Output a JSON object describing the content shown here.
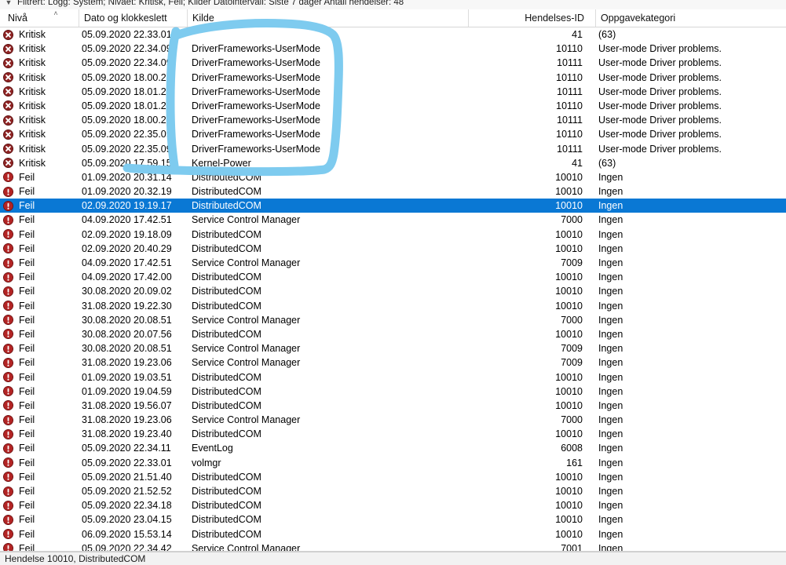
{
  "window": {
    "filter_bar_text": "Filtrert: Logg: System; Nivået: Kritisk, Feil; Kilder Datointervall: Siste 7 dager Antall hendelser: 48",
    "filter_bar_caret": "▼"
  },
  "columns": {
    "level": "Nivå",
    "datetime": "Dato og klokkeslett",
    "source": "Kilde",
    "event_id": "Hendelses-ID",
    "task_category": "Oppgavekategori",
    "sort_caret": "˄"
  },
  "icons": {
    "critical": "critical-error-icon",
    "error": "error-icon"
  },
  "colors": {
    "selection": "#0a78d4",
    "annotation_blue": "#7ecbef",
    "critical_icon": "#8e2323",
    "error_icon": "#b32424"
  },
  "statusbar": {
    "text": "Hendelse 10010, DistributedCOM"
  },
  "annotation": {
    "description": "hand-drawn blue rectangle around the DriverFrameworks-UserMode source entries"
  },
  "rows": [
    {
      "level": "Kritisk",
      "sev": "critical",
      "datetime": "05.09.2020 22.33.01",
      "source": "",
      "event_id": "41",
      "task_category": "(63)",
      "selected": false
    },
    {
      "level": "Kritisk",
      "sev": "critical",
      "datetime": "05.09.2020 22.34.09",
      "source": "DriverFrameworks-UserMode",
      "event_id": "10110",
      "task_category": "User-mode Driver problems.",
      "selected": false
    },
    {
      "level": "Kritisk",
      "sev": "critical",
      "datetime": "05.09.2020 22.34.09",
      "source": "DriverFrameworks-UserMode",
      "event_id": "10111",
      "task_category": "User-mode Driver problems.",
      "selected": false
    },
    {
      "level": "Kritisk",
      "sev": "critical",
      "datetime": "05.09.2020 18.00.24",
      "source": "DriverFrameworks-UserMode",
      "event_id": "10110",
      "task_category": "User-mode Driver problems.",
      "selected": false
    },
    {
      "level": "Kritisk",
      "sev": "critical",
      "datetime": "05.09.2020 18.01.24",
      "source": "DriverFrameworks-UserMode",
      "event_id": "10111",
      "task_category": "User-mode Driver problems.",
      "selected": false
    },
    {
      "level": "Kritisk",
      "sev": "critical",
      "datetime": "05.09.2020 18.01.24",
      "source": "DriverFrameworks-UserMode",
      "event_id": "10110",
      "task_category": "User-mode Driver problems.",
      "selected": false
    },
    {
      "level": "Kritisk",
      "sev": "critical",
      "datetime": "05.09.2020 18.00.24",
      "source": "DriverFrameworks-UserMode",
      "event_id": "10111",
      "task_category": "User-mode Driver problems.",
      "selected": false
    },
    {
      "level": "Kritisk",
      "sev": "critical",
      "datetime": "05.09.2020 22.35.09",
      "source": "DriverFrameworks-UserMode",
      "event_id": "10110",
      "task_category": "User-mode Driver problems.",
      "selected": false
    },
    {
      "level": "Kritisk",
      "sev": "critical",
      "datetime": "05.09.2020 22.35.09",
      "source": "DriverFrameworks-UserMode",
      "event_id": "10111",
      "task_category": "User-mode Driver problems.",
      "selected": false
    },
    {
      "level": "Kritisk",
      "sev": "critical",
      "datetime": "05.09.2020 17.59.15",
      "source": "Kernel-Power",
      "event_id": "41",
      "task_category": "(63)",
      "selected": false
    },
    {
      "level": "Feil",
      "sev": "error",
      "datetime": "01.09.2020 20.31.14",
      "source": "DistributedCOM",
      "event_id": "10010",
      "task_category": "Ingen",
      "selected": false
    },
    {
      "level": "Feil",
      "sev": "error",
      "datetime": "01.09.2020 20.32.19",
      "source": "DistributedCOM",
      "event_id": "10010",
      "task_category": "Ingen",
      "selected": false
    },
    {
      "level": "Feil",
      "sev": "error",
      "datetime": "02.09.2020 19.19.17",
      "source": "DistributedCOM",
      "event_id": "10010",
      "task_category": "Ingen",
      "selected": true
    },
    {
      "level": "Feil",
      "sev": "error",
      "datetime": "04.09.2020 17.42.51",
      "source": "Service Control Manager",
      "event_id": "7000",
      "task_category": "Ingen",
      "selected": false
    },
    {
      "level": "Feil",
      "sev": "error",
      "datetime": "02.09.2020 19.18.09",
      "source": "DistributedCOM",
      "event_id": "10010",
      "task_category": "Ingen",
      "selected": false
    },
    {
      "level": "Feil",
      "sev": "error",
      "datetime": "02.09.2020 20.40.29",
      "source": "DistributedCOM",
      "event_id": "10010",
      "task_category": "Ingen",
      "selected": false
    },
    {
      "level": "Feil",
      "sev": "error",
      "datetime": "04.09.2020 17.42.51",
      "source": "Service Control Manager",
      "event_id": "7009",
      "task_category": "Ingen",
      "selected": false
    },
    {
      "level": "Feil",
      "sev": "error",
      "datetime": "04.09.2020 17.42.00",
      "source": "DistributedCOM",
      "event_id": "10010",
      "task_category": "Ingen",
      "selected": false
    },
    {
      "level": "Feil",
      "sev": "error",
      "datetime": "30.08.2020 20.09.02",
      "source": "DistributedCOM",
      "event_id": "10010",
      "task_category": "Ingen",
      "selected": false
    },
    {
      "level": "Feil",
      "sev": "error",
      "datetime": "31.08.2020 19.22.30",
      "source": "DistributedCOM",
      "event_id": "10010",
      "task_category": "Ingen",
      "selected": false
    },
    {
      "level": "Feil",
      "sev": "error",
      "datetime": "30.08.2020 20.08.51",
      "source": "Service Control Manager",
      "event_id": "7000",
      "task_category": "Ingen",
      "selected": false
    },
    {
      "level": "Feil",
      "sev": "error",
      "datetime": "30.08.2020 20.07.56",
      "source": "DistributedCOM",
      "event_id": "10010",
      "task_category": "Ingen",
      "selected": false
    },
    {
      "level": "Feil",
      "sev": "error",
      "datetime": "30.08.2020 20.08.51",
      "source": "Service Control Manager",
      "event_id": "7009",
      "task_category": "Ingen",
      "selected": false
    },
    {
      "level": "Feil",
      "sev": "error",
      "datetime": "31.08.2020 19.23.06",
      "source": "Service Control Manager",
      "event_id": "7009",
      "task_category": "Ingen",
      "selected": false
    },
    {
      "level": "Feil",
      "sev": "error",
      "datetime": "01.09.2020 19.03.51",
      "source": "DistributedCOM",
      "event_id": "10010",
      "task_category": "Ingen",
      "selected": false
    },
    {
      "level": "Feil",
      "sev": "error",
      "datetime": "01.09.2020 19.04.59",
      "source": "DistributedCOM",
      "event_id": "10010",
      "task_category": "Ingen",
      "selected": false
    },
    {
      "level": "Feil",
      "sev": "error",
      "datetime": "31.08.2020 19.56.07",
      "source": "DistributedCOM",
      "event_id": "10010",
      "task_category": "Ingen",
      "selected": false
    },
    {
      "level": "Feil",
      "sev": "error",
      "datetime": "31.08.2020 19.23.06",
      "source": "Service Control Manager",
      "event_id": "7000",
      "task_category": "Ingen",
      "selected": false
    },
    {
      "level": "Feil",
      "sev": "error",
      "datetime": "31.08.2020 19.23.40",
      "source": "DistributedCOM",
      "event_id": "10010",
      "task_category": "Ingen",
      "selected": false
    },
    {
      "level": "Feil",
      "sev": "error",
      "datetime": "05.09.2020 22.34.11",
      "source": "EventLog",
      "event_id": "6008",
      "task_category": "Ingen",
      "selected": false
    },
    {
      "level": "Feil",
      "sev": "error",
      "datetime": "05.09.2020 22.33.01",
      "source": "volmgr",
      "event_id": "161",
      "task_category": "Ingen",
      "selected": false
    },
    {
      "level": "Feil",
      "sev": "error",
      "datetime": "05.09.2020 21.51.40",
      "source": "DistributedCOM",
      "event_id": "10010",
      "task_category": "Ingen",
      "selected": false
    },
    {
      "level": "Feil",
      "sev": "error",
      "datetime": "05.09.2020 21.52.52",
      "source": "DistributedCOM",
      "event_id": "10010",
      "task_category": "Ingen",
      "selected": false
    },
    {
      "level": "Feil",
      "sev": "error",
      "datetime": "05.09.2020 22.34.18",
      "source": "DistributedCOM",
      "event_id": "10010",
      "task_category": "Ingen",
      "selected": false
    },
    {
      "level": "Feil",
      "sev": "error",
      "datetime": "05.09.2020 23.04.15",
      "source": "DistributedCOM",
      "event_id": "10010",
      "task_category": "Ingen",
      "selected": false
    },
    {
      "level": "Feil",
      "sev": "error",
      "datetime": "06.09.2020 15.53.14",
      "source": "DistributedCOM",
      "event_id": "10010",
      "task_category": "Ingen",
      "selected": false
    },
    {
      "level": "Feil",
      "sev": "error",
      "datetime": "05.09.2020 22.34.42",
      "source": "Service Control Manager",
      "event_id": "7001",
      "task_category": "Ingen",
      "selected": false
    }
  ]
}
